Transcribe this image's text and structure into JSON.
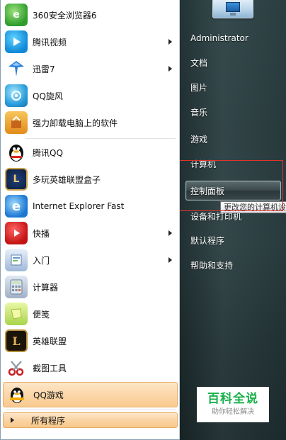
{
  "left_programs": [
    {
      "label": "360安全浏览器6",
      "icon": "360-browser-icon",
      "has_submenu": false
    },
    {
      "label": "腾讯视频",
      "icon": "tencent-video-icon",
      "has_submenu": true
    },
    {
      "label": "迅雷7",
      "icon": "xunlei-icon",
      "has_submenu": true
    },
    {
      "label": "QQ旋风",
      "icon": "qq-xuanfeng-icon",
      "has_submenu": false
    },
    {
      "label": "强力卸载电脑上的软件",
      "icon": "uninstall-icon",
      "has_submenu": false
    },
    {
      "label": "腾讯QQ",
      "icon": "qq-penguin-icon",
      "has_submenu": false
    },
    {
      "label": "多玩英雄联盟盒子",
      "icon": "lol-box-icon",
      "has_submenu": false
    },
    {
      "label": "Internet Explorer Fast",
      "icon": "internet-explorer-icon",
      "has_submenu": false
    },
    {
      "label": "快播",
      "icon": "kuaibo-icon",
      "has_submenu": true
    },
    {
      "label": "入门",
      "icon": "getting-started-icon",
      "has_submenu": true
    },
    {
      "label": "计算器",
      "icon": "calculator-icon",
      "has_submenu": false
    },
    {
      "label": "便笺",
      "icon": "sticky-notes-icon",
      "has_submenu": false
    },
    {
      "label": "英雄联盟",
      "icon": "league-of-legends-icon",
      "has_submenu": false
    },
    {
      "label": "截图工具",
      "icon": "snipping-tool-icon",
      "has_submenu": false
    },
    {
      "label": "QQ游戏",
      "icon": "qq-game-icon",
      "has_submenu": false
    }
  ],
  "all_programs_label": "所有程序",
  "right_items": [
    {
      "label": "Administrator"
    },
    {
      "label": "文档"
    },
    {
      "label": "图片"
    },
    {
      "label": "音乐"
    },
    {
      "label": "游戏"
    },
    {
      "label": "计算机"
    },
    {
      "label": "控制面板"
    },
    {
      "label": "设备和打印机"
    },
    {
      "label": "默认程序"
    },
    {
      "label": "帮助和支持"
    }
  ],
  "tooltip_text": "更改您的计算机设置",
  "watermark": {
    "title": "百科全说",
    "subtitle": "助你轻松解决"
  },
  "colors": {
    "highlight": "#fbd7a9",
    "annotation_box": "#e0332b"
  }
}
